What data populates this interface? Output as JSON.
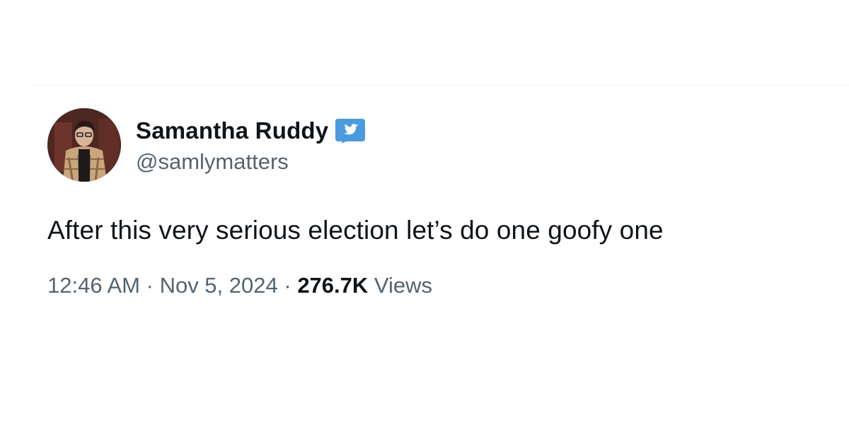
{
  "tweet": {
    "author": {
      "display_name": "Samantha Ruddy",
      "handle": "@samlymatters",
      "verified": true,
      "verified_icon": "twitter-bird-verified-badge",
      "avatar_icon": "profile-photo"
    },
    "text": "After this very serious election let’s do one goofy one",
    "time": "12:46 AM",
    "separator": "·",
    "date": "Nov 5, 2024",
    "views_count": "276.7K",
    "views_label": "Views"
  },
  "colors": {
    "text_primary": "#0f1419",
    "text_secondary": "#536471",
    "badge_blue": "#4a9bdd"
  }
}
